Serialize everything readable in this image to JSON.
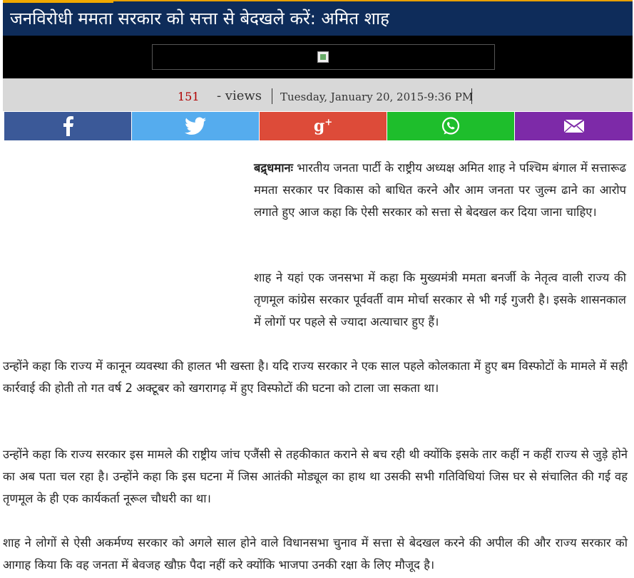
{
  "article": {
    "title": "जनविरोधी ममता सरकार को सत्ता से बेदखले करें: अमित शाह",
    "views_count": "151",
    "views_label": "- views",
    "date": "Tuesday, January 20, 2015-9:36 PM",
    "dateline": "बद्र्धमानः",
    "paragraphs": [
      "भारतीय जनता पार्टी के राष्ट्रीय अध्यक्ष अमित शाह ने पश्चिम बंगाल में सत्तारूढ ममता सरकार पर विकास को बाधित करने और आम जनता पर जुल्म ढाने का आरोप लगाते हुए आज कहा कि ऐसी सरकार को सत्ता से बेदखल कर दिया जाना चाहिए।",
      "शाह ने यहां एक जनसभा में कहा कि मुख्यमंत्री ममता बनर्जी के नेतृत्व वाली राज्य की तृणमूल कांग्रेस सरकार पूर्ववर्ती वाम मोर्चा सरकार से भी गई गुजरी है। इसके शासनकाल में लोगों पर पहले से ज्यादा अत्याचार हुए हैं।",
      "उन्होंने कहा कि राज्य में कानून व्यवस्था की हालत भी खस्ता है। यदि राज्य सरकार ने एक साल पहले कोलकाता में हुए बम विस्फोटों के मामले में सही कार्रवाई की होती तो गत वर्ष 2 अक्टूबर को खगरागढ़ में हुए विस्फोटों की घटना को टाला जा सकता था।",
      "उन्होंने कहा कि राज्य सरकार इस मामले की राष्ट्रीय जांच एजैंसी से तहकीकात कराने से बच रही थी क्योंकि इसके तार कहीं न कहीं राज्य से जुड़े होने का अब पता चल रहा है। उन्होंने कहा कि इस घटना में जिस आतंकी मोड्यूल का हाथ था उसकी सभी गतिविधियां जिस घर से संचालित की गई वह तृणमूल के ही एक कार्यकर्ता नूरूल चौधरी का था।",
      "शाह ने लोगों से ऐसी अकर्मण्य सरकार को अगले साल होने वाले विधानसभा चुनाव में सत्ता से बेदखल करने की अपील की और राज्य सरकार को आगाह किया कि वह जनता में बेवजह खौफ़ पैदा नहीं करे क्योंकि भाजपा उनकी रक्षा के लिए मौजूद है।"
    ]
  },
  "share": {
    "facebook_icon": "facebook-icon",
    "twitter_icon": "twitter-icon",
    "googleplus_icon": "google-plus-icon",
    "whatsapp_icon": "whatsapp-icon",
    "email_icon": "email-icon",
    "colors": {
      "facebook": "#3b5998",
      "twitter": "#55acee",
      "googleplus": "#dd4b39",
      "whatsapp": "#1ebe2c",
      "email": "#7d2aa8"
    }
  },
  "theme": {
    "title_bg": "#0e2c5a",
    "accent": "#f0a800",
    "meta_bg": "#d8d8d8"
  }
}
